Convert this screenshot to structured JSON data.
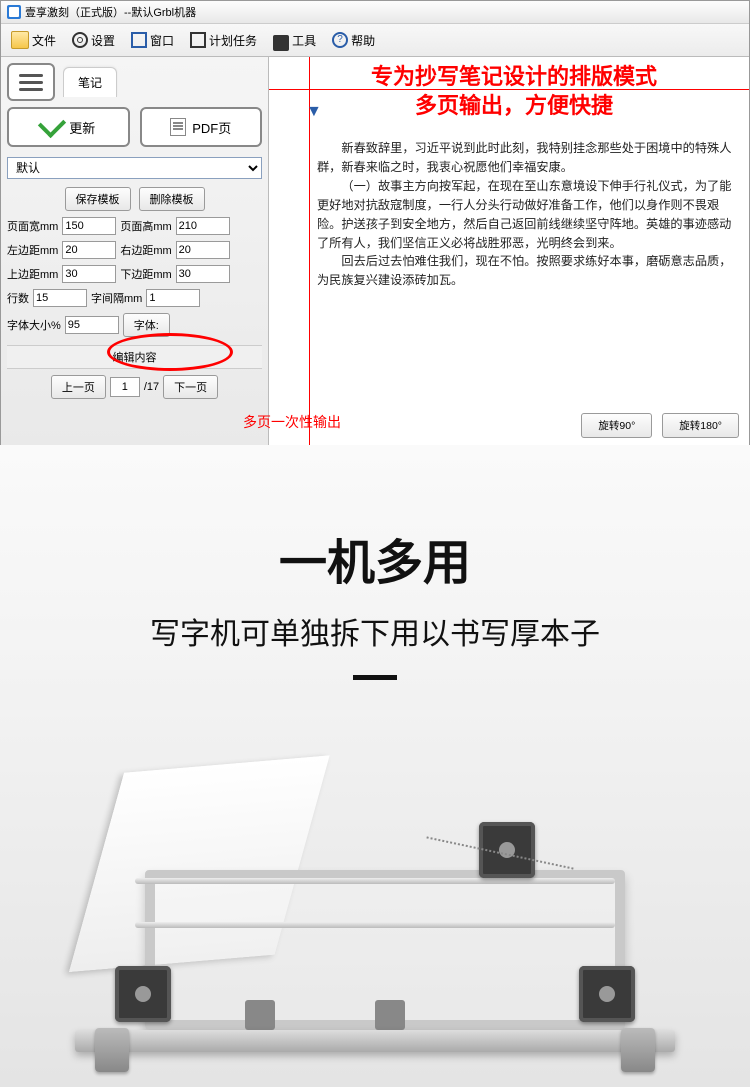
{
  "titlebar": {
    "label": "壹享激刻（正式版）--默认Grbl机器"
  },
  "toolbar": {
    "file": "文件",
    "settings": "设置",
    "window": "窗口",
    "plan": "计划任务",
    "tools": "工具",
    "help": "帮助"
  },
  "sidebar": {
    "tab_label": "笔记",
    "update_btn": "更新",
    "pdf_btn": "PDF页",
    "dropdown_value": "默认",
    "save_template": "保存模板",
    "delete_template": "删除模板",
    "page_width_label": "页面宽mm",
    "page_width_value": "150",
    "page_height_label": "页面高mm",
    "page_height_value": "210",
    "left_margin_label": "左边距mm",
    "left_margin_value": "20",
    "right_margin_label": "右边距mm",
    "right_margin_value": "20",
    "top_margin_label": "上边距mm",
    "top_margin_value": "30",
    "bottom_margin_label": "下边距mm",
    "bottom_margin_value": "30",
    "lines_label": "行数",
    "lines_value": "15",
    "line_gap_label": "字间隔mm",
    "line_gap_value": "1",
    "font_size_label": "字体大小%",
    "font_size_value": "95",
    "font_btn": "字体:",
    "edit_content": "编辑内容",
    "prev_page": "上一页",
    "page_current": "1",
    "page_sep": "/17",
    "next_page": "下一页"
  },
  "annotations": {
    "headline_l1": "专为抄写笔记设计的排版模式",
    "headline_l2": "多页输出，方便快捷",
    "output_note": "多页一次性输出"
  },
  "rotate": {
    "r90": "旋转90°",
    "r180": "旋转180°"
  },
  "handwriting": {
    "p1": "新春致辞里，习近平说到此时此刻，我特别挂念那些处于困境中的特殊人群，新春来临之时，我衷心祝愿他们幸福安康。",
    "p2": "（一）故事主方向按军起，在现在至山东意境设下伸手行礼仪式，为了能更好地对抗敌寇制度，一行人分头行动做好准备工作，他们以身作则不畏艰险。护送孩子到安全地方，然后自己返回前线继续坚守阵地。英雄的事迹感动了所有人，我们坚信正义必将战胜邪恶，光明终会到来。",
    "p3": "回去后过去怕难住我们，现在不怕。按照要求练好本事，磨砺意志品质，为民族复兴建设添砖加瓦。"
  },
  "promo": {
    "title": "一机多用",
    "subtitle": "写字机可单独拆下用以书写厚本子"
  }
}
